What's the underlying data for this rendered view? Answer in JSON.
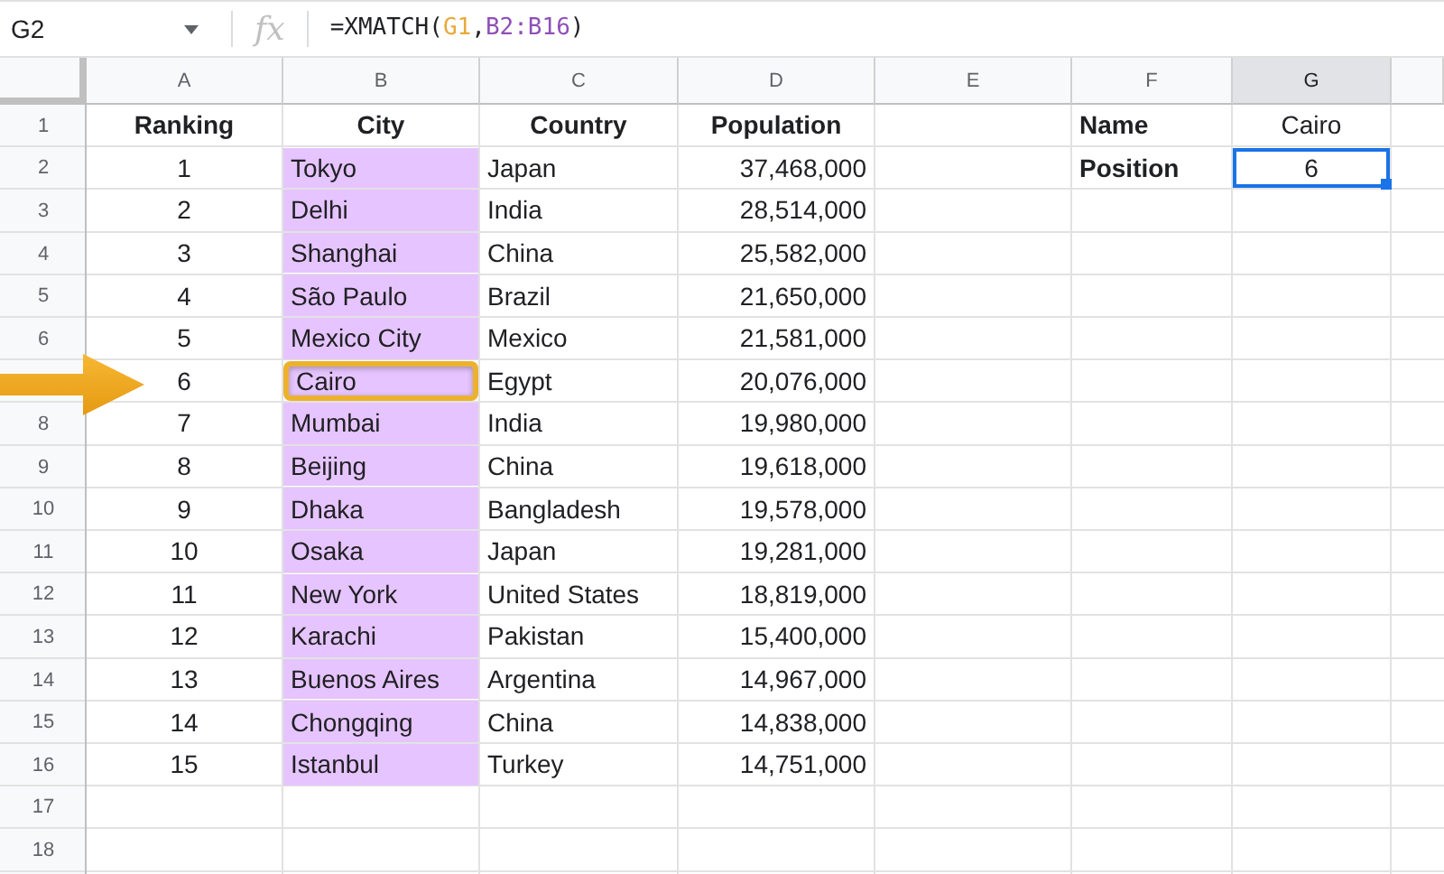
{
  "formula_bar": {
    "name_box": "G2",
    "fx_label": "fx",
    "formula": [
      {
        "text": "=XMATCH(",
        "color": "#202124"
      },
      {
        "text": "G1",
        "color": "#e8a93b",
        "separator": ","
      },
      {
        "text": "B2:B16",
        "color": "#8e4fb8"
      },
      {
        "text": ")",
        "color": "#202124"
      }
    ]
  },
  "columns": [
    {
      "label": "A",
      "selected": false
    },
    {
      "label": "B",
      "selected": false
    },
    {
      "label": "C",
      "selected": false
    },
    {
      "label": "D",
      "selected": false
    },
    {
      "label": "E",
      "selected": false
    },
    {
      "label": "F",
      "selected": false
    },
    {
      "label": "G",
      "selected": true
    }
  ],
  "rows": [
    {
      "label": "1",
      "cells": {
        "A": {
          "text": "Ranking",
          "bold": true
        },
        "B": {
          "text": "City",
          "bold": true
        },
        "C": {
          "text": "Country",
          "bold": true
        },
        "D": {
          "text": "Population",
          "bold": true
        },
        "F": {
          "text": "Name",
          "bold": true
        },
        "G": {
          "text": "Cairo"
        }
      }
    },
    {
      "label": "2",
      "cells": {
        "A": {
          "text": "1"
        },
        "B": {
          "text": "Tokyo",
          "highlighted": true
        },
        "C": {
          "text": "Japan"
        },
        "D": {
          "text": "37,468,000"
        },
        "F": {
          "text": "Position",
          "bold": true
        },
        "G": {
          "text": "6",
          "selected": true
        }
      }
    },
    {
      "label": "3",
      "cells": {
        "A": {
          "text": "2"
        },
        "B": {
          "text": "Delhi",
          "highlighted": true
        },
        "C": {
          "text": "India"
        },
        "D": {
          "text": "28,514,000"
        }
      }
    },
    {
      "label": "4",
      "cells": {
        "A": {
          "text": "3"
        },
        "B": {
          "text": "Shanghai",
          "highlighted": true
        },
        "C": {
          "text": "China"
        },
        "D": {
          "text": "25,582,000"
        }
      }
    },
    {
      "label": "5",
      "cells": {
        "A": {
          "text": "4"
        },
        "B": {
          "text": "São Paulo",
          "highlighted": true
        },
        "C": {
          "text": "Brazil"
        },
        "D": {
          "text": "21,650,000"
        }
      }
    },
    {
      "label": "6",
      "cells": {
        "A": {
          "text": "5"
        },
        "B": {
          "text": "Mexico City",
          "highlighted": true
        },
        "C": {
          "text": "Mexico"
        },
        "D": {
          "text": "21,581,000"
        }
      }
    },
    {
      "callout_arrow": true,
      "cells": {
        "A": {
          "text": "6"
        },
        "B": {
          "text": "Cairo",
          "highlighted": true,
          "callout": true
        },
        "C": {
          "text": "Egypt"
        },
        "D": {
          "text": "20,076,000"
        }
      }
    },
    {
      "label": "8",
      "cells": {
        "A": {
          "text": "7"
        },
        "B": {
          "text": "Mumbai",
          "highlighted": true
        },
        "C": {
          "text": "India"
        },
        "D": {
          "text": "19,980,000"
        }
      }
    },
    {
      "label": "9",
      "cells": {
        "A": {
          "text": "8"
        },
        "B": {
          "text": "Beijing",
          "highlighted": true
        },
        "C": {
          "text": "China"
        },
        "D": {
          "text": "19,618,000"
        }
      }
    },
    {
      "label": "10",
      "cells": {
        "A": {
          "text": "9"
        },
        "B": {
          "text": "Dhaka",
          "highlighted": true
        },
        "C": {
          "text": "Bangladesh"
        },
        "D": {
          "text": "19,578,000"
        }
      }
    },
    {
      "label": "11",
      "cells": {
        "A": {
          "text": "10"
        },
        "B": {
          "text": "Osaka",
          "highlighted": true
        },
        "C": {
          "text": "Japan"
        },
        "D": {
          "text": "19,281,000"
        }
      }
    },
    {
      "label": "12",
      "cells": {
        "A": {
          "text": "11"
        },
        "B": {
          "text": "New York",
          "highlighted": true
        },
        "C": {
          "text": "United States"
        },
        "D": {
          "text": "18,819,000"
        }
      }
    },
    {
      "label": "13",
      "cells": {
        "A": {
          "text": "12"
        },
        "B": {
          "text": "Karachi",
          "highlighted": true
        },
        "C": {
          "text": "Pakistan"
        },
        "D": {
          "text": "15,400,000"
        }
      }
    },
    {
      "label": "14",
      "cells": {
        "A": {
          "text": "13"
        },
        "B": {
          "text": "Buenos Aires",
          "highlighted": true
        },
        "C": {
          "text": "Argentina"
        },
        "D": {
          "text": "14,967,000"
        }
      }
    },
    {
      "label": "15",
      "cells": {
        "A": {
          "text": "14"
        },
        "B": {
          "text": "Chongqing",
          "highlighted": true
        },
        "C": {
          "text": "China"
        },
        "D": {
          "text": "14,838,000"
        }
      }
    },
    {
      "label": "16",
      "cells": {
        "A": {
          "text": "15"
        },
        "B": {
          "text": "Istanbul",
          "highlighted": true
        },
        "C": {
          "text": "Turkey"
        },
        "D": {
          "text": "14,751,000"
        }
      }
    },
    {
      "label": "17",
      "cells": {}
    },
    {
      "label": "18",
      "cells": {}
    }
  ]
}
